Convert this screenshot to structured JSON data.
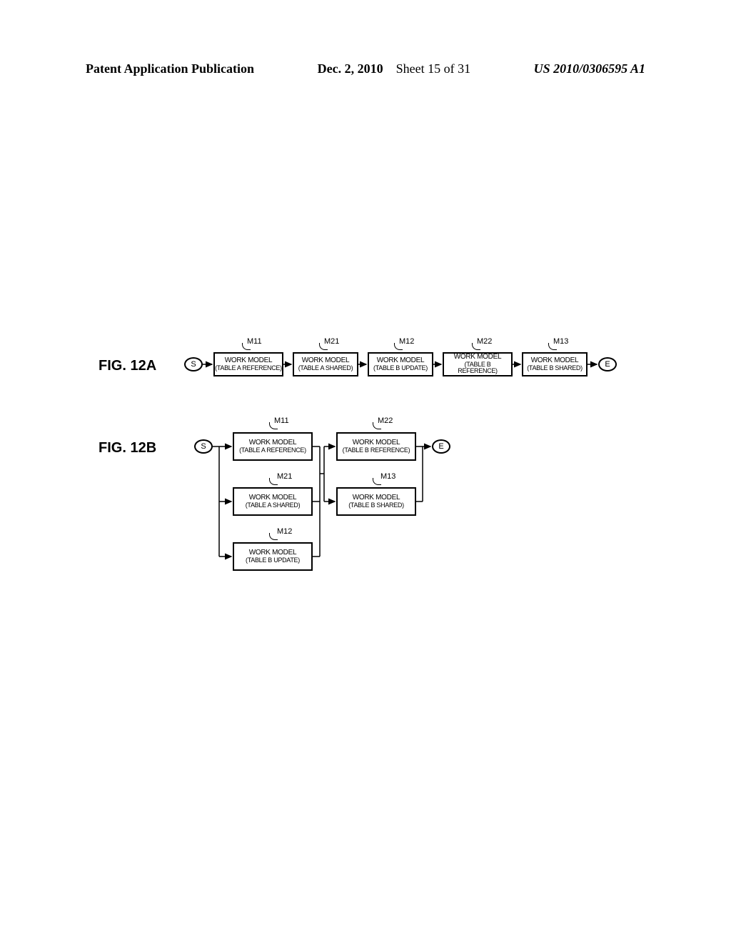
{
  "header": {
    "left": "Patent Application Publication",
    "date": "Dec. 2, 2010",
    "sheet": "Sheet 15 of 31",
    "pub": "US 2010/0306595 A1"
  },
  "fig12a": {
    "label": "FIG. 12A",
    "start": "S",
    "end": "E",
    "boxes": [
      {
        "ref": "M11",
        "line1": "WORK MODEL",
        "line2": "(TABLE A REFERENCE)"
      },
      {
        "ref": "M21",
        "line1": "WORK MODEL",
        "line2": "(TABLE A SHARED)"
      },
      {
        "ref": "M12",
        "line1": "WORK MODEL",
        "line2": "(TABLE B UPDATE)"
      },
      {
        "ref": "M22",
        "line1": "WORK MODEL",
        "line2": "(TABLE B REFERENCE)"
      },
      {
        "ref": "M13",
        "line1": "WORK MODEL",
        "line2": "(TABLE B SHARED)"
      }
    ]
  },
  "fig12b": {
    "label": "FIG. 12B",
    "start": "S",
    "end": "E",
    "col1": [
      {
        "ref": "M11",
        "line1": "WORK MODEL",
        "line2": "(TABLE A REFERENCE)"
      },
      {
        "ref": "M21",
        "line1": "WORK MODEL",
        "line2": "(TABLE A SHARED)"
      },
      {
        "ref": "M12",
        "line1": "WORK MODEL",
        "line2": "(TABLE B UPDATE)"
      }
    ],
    "col2": [
      {
        "ref": "M22",
        "line1": "WORK MODEL",
        "line2": "(TABLE B REFERENCE)"
      },
      {
        "ref": "M13",
        "line1": "WORK MODEL",
        "line2": "(TABLE B SHARED)"
      }
    ]
  }
}
